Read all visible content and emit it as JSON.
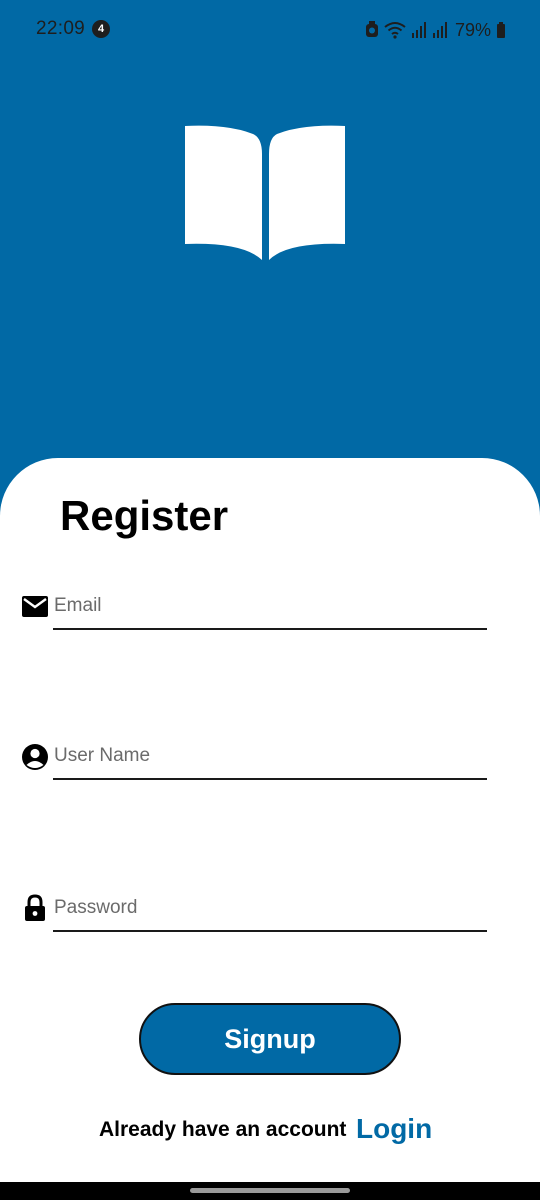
{
  "status_bar": {
    "time": "22:09",
    "notification_count": "4",
    "battery_percent": "79%"
  },
  "logo": {
    "icon": "open-book-icon"
  },
  "form": {
    "title": "Register",
    "email": {
      "placeholder": "Email",
      "value": "",
      "icon": "envelope-icon"
    },
    "username": {
      "placeholder": "User Name",
      "value": "",
      "icon": "account-circle-icon"
    },
    "password": {
      "placeholder": "Password",
      "value": "",
      "icon": "lock-icon"
    },
    "signup_label": "Signup"
  },
  "footer": {
    "prompt": "Already have an account",
    "login_label": "Login"
  },
  "colors": {
    "primary": "#0169a5",
    "background": "#ffffff",
    "text": "#000000"
  }
}
